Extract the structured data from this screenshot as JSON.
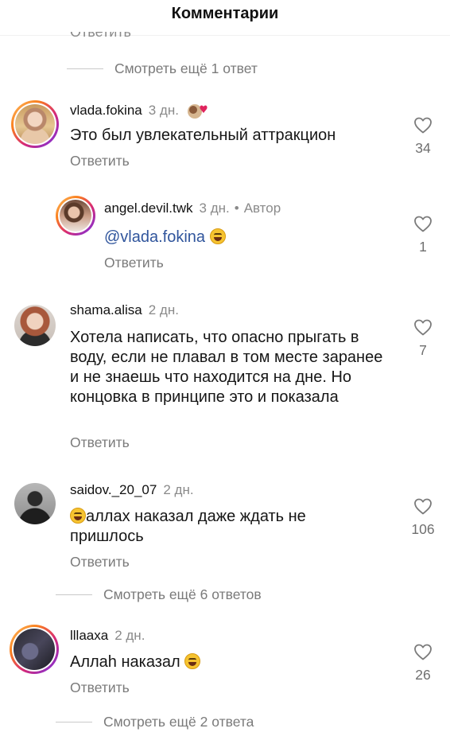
{
  "header": {
    "title": "Комментарии"
  },
  "top_partial_reply": "Ответить",
  "top_view_more": "Смотреть ещё 1 ответ",
  "comments": [
    {
      "username": "vlada.fokina",
      "time": "3 дн.",
      "text": "Это был увлекательный аттракцион",
      "reply": "Ответить",
      "likes": "34",
      "has_story_ring": true
    },
    {
      "username": "angel.devil.twk",
      "time": "3 дн.",
      "author_badge": "Автор",
      "mention": "@vlada.fokina",
      "reply": "Ответить",
      "likes": "1",
      "has_story_ring": true,
      "is_reply": true
    },
    {
      "username": "shama.alisa",
      "time": "2 дн.",
      "text": "Хотела написать, что опасно прыгать в воду, если не плавал в том месте заранее и не знаешь что находится на дне. Но концовка в принципе это и показала",
      "reply": "Ответить",
      "likes": "7",
      "has_story_ring": false
    },
    {
      "username": "saidov._20_07",
      "time": "2 дн.",
      "text": "аллах наказал даже ждать не пришлось",
      "reply": "Ответить",
      "likes": "106",
      "has_story_ring": false
    },
    {
      "username": "lllaaxa",
      "time": "2 дн.",
      "text": "Аллаh наказал",
      "reply": "Ответить",
      "likes": "26",
      "has_story_ring": true
    }
  ],
  "view_more_1": "Смотреть ещё 6 ответов",
  "view_more_2": "Смотреть ещё 2 ответа",
  "colors": {
    "mention": "#30559c",
    "secondary_text": "#7a7a7a",
    "story_ring": [
      "#fdc468",
      "#d62976",
      "#4f5bd5"
    ]
  }
}
